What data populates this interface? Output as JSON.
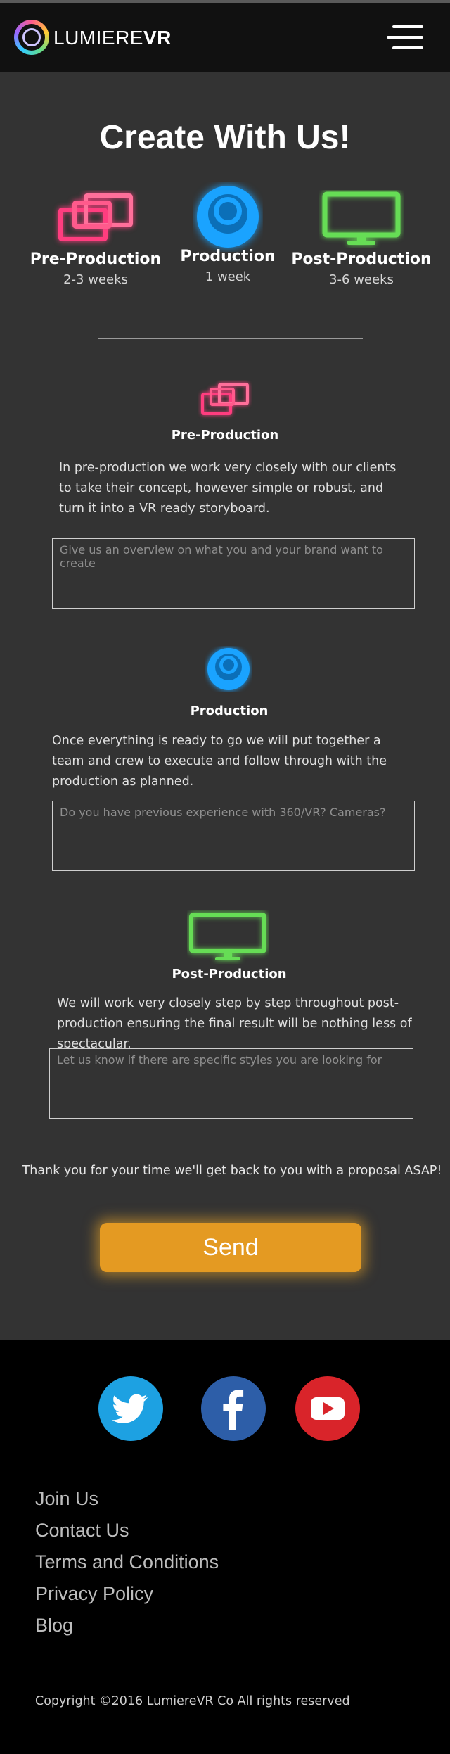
{
  "header": {
    "logo_light": "LUMIERE",
    "logo_bold": "VR",
    "menu_icon": "hamburger-menu-icon"
  },
  "page": {
    "title": "Create With Us!"
  },
  "phases": [
    {
      "name": "Pre-Production",
      "duration": "2-3 weeks",
      "icon": "overlapping-screens-icon",
      "color": "#ff3d7f"
    },
    {
      "name": "Production",
      "duration": "1 week",
      "icon": "camera-lens-icon",
      "color": "#1aa3ff"
    },
    {
      "name": "Post-Production",
      "duration": "3-6 weeks",
      "icon": "monitor-icon",
      "color": "#66dd55"
    }
  ],
  "sections": {
    "pre": {
      "title": "Pre-Production",
      "description": "In pre-production we work  very closely with our clients to take their concept, however simple or robust, and turn it into a VR ready storyboard.",
      "placeholder": "Give us an overview on what you and your brand want to create"
    },
    "production": {
      "title": "Production",
      "description": "Once everything is ready to go we will put together a team and crew to execute and follow through with the production as planned.",
      "placeholder": "Do you have previous experience with 360/VR? Cameras?"
    },
    "post": {
      "title": "Post-Production",
      "description": "We will work very closely step by step throughout post-production ensuring the final result will be nothing less of spectacular.",
      "placeholder": "Let us know if there are specific styles you are looking for"
    }
  },
  "form": {
    "thanks": "Thank you for your time we'll get back to you with a proposal ASAP!",
    "send_label": "Send"
  },
  "footer": {
    "social": [
      {
        "name": "twitter",
        "icon": "twitter-bird-icon",
        "color": "#1da1e2"
      },
      {
        "name": "facebook",
        "icon": "facebook-f-icon",
        "color": "#2d5ea8"
      },
      {
        "name": "youtube",
        "icon": "youtube-play-icon",
        "color": "#d9242a"
      }
    ],
    "links": [
      "Join Us",
      "Contact Us",
      "Terms and Conditions",
      "Privacy Policy",
      "Blog"
    ],
    "copyright": "Copyright ©2016 LumiereVR Co All rights reserved"
  }
}
